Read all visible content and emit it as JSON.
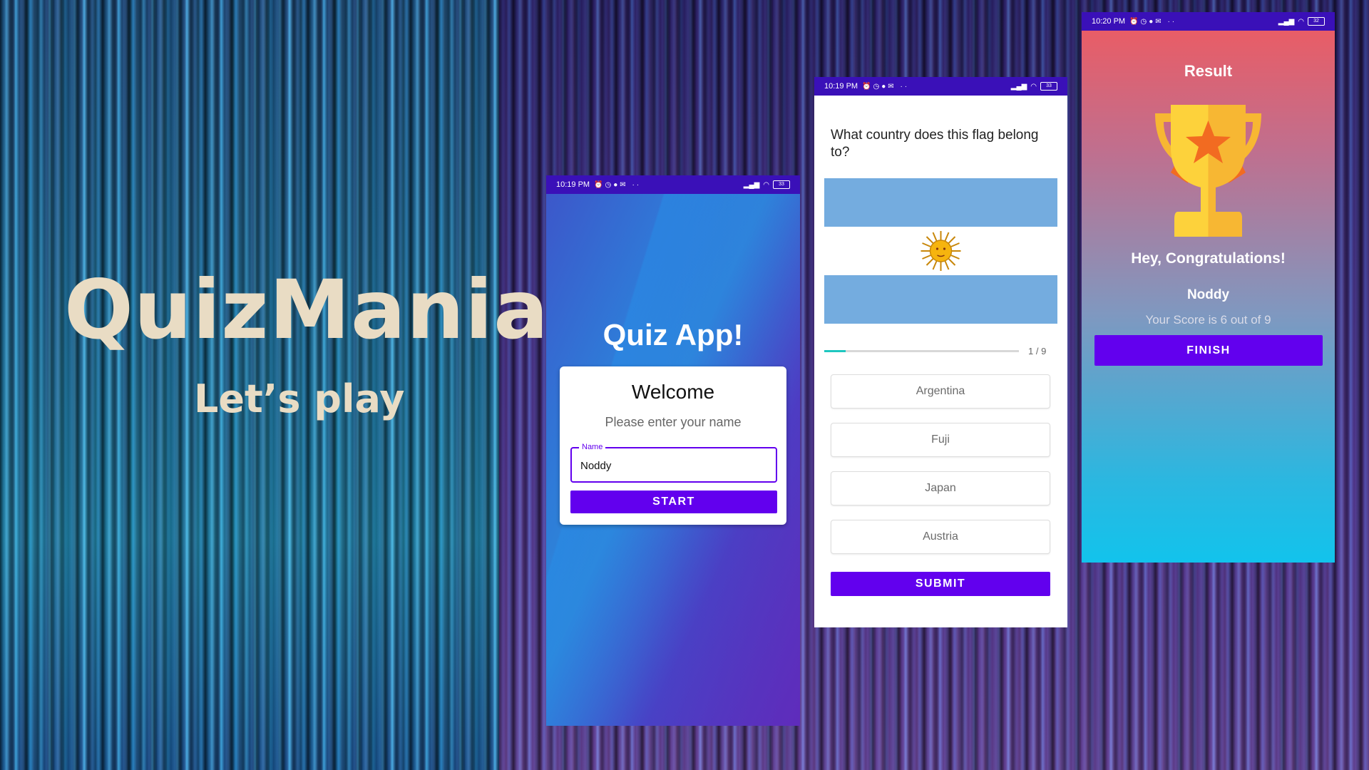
{
  "branding": {
    "title": "QuizMania",
    "subtitle": "Let’s play"
  },
  "welcome_screen": {
    "status_time": "10:19 PM",
    "battery": "33",
    "app_title": "Quiz App!",
    "card_heading": "Welcome",
    "card_prompt": "Please enter your name",
    "name_label": "Name",
    "name_value": "Noddy",
    "start_label": "START"
  },
  "question_screen": {
    "status_time": "10:19 PM",
    "battery": "33",
    "question": "What country does this flag belong to?",
    "progress_fraction": 0.111,
    "progress_text": "1 / 9",
    "options": [
      "Argentina",
      "Fuji",
      "Japan",
      "Austria"
    ],
    "submit_label": "SUBMIT",
    "flag_colors": {
      "stripe": "#74acdf",
      "middle": "#ffffff",
      "sun": "#f6b40e"
    }
  },
  "result_screen": {
    "status_time": "10:20 PM",
    "battery": "32",
    "title": "Result",
    "congrats": "Hey, Congratulations!",
    "player_name": "Noddy",
    "score_text": "Your Score is 6 out of 9",
    "finish_label": "FINISH"
  },
  "colors": {
    "accent": "#6200ee",
    "statusbar": "#3a10b8",
    "progress": "#1ec7c0",
    "brand_text": "#e9dcc4"
  }
}
